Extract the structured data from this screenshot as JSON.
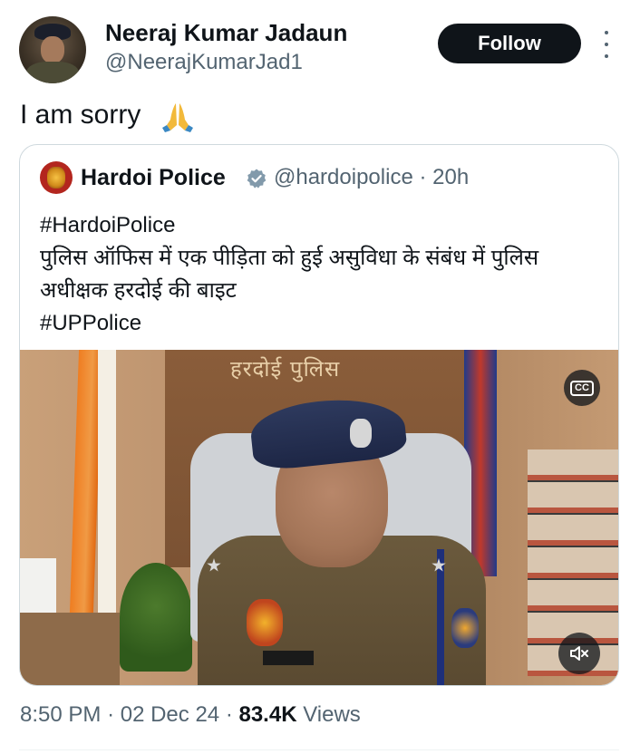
{
  "author": {
    "name": "Neeraj Kumar Jadaun",
    "handle": "@NeerajKumarJad1"
  },
  "follow_label": "Follow",
  "tweet": {
    "text": "I am sorry",
    "emoji_icon": "folded-hands-icon"
  },
  "quoted": {
    "name": "Hardoi Police",
    "handle": "@hardoipolice",
    "time": "20h",
    "separator": "·",
    "lines": [
      "#HardoiPolice",
      "पुलिस ऑफिस में एक पीड़िता को हुई असुविधा के संबंध में पुलिस",
      "अधीक्षक हरदोई की बाइट",
      "#UPPolice"
    ],
    "video": {
      "wall_text": "हरदोई पुलिस",
      "cc_label": "CC"
    }
  },
  "footer": {
    "time": "8:50 PM",
    "date": "02 Dec 24",
    "views_count": "83.4K",
    "views_label": "Views",
    "separator": "·"
  },
  "colors": {
    "text": "#0f1419",
    "secondary": "#536471",
    "verified": "#829aab",
    "border": "#cfd9de"
  }
}
